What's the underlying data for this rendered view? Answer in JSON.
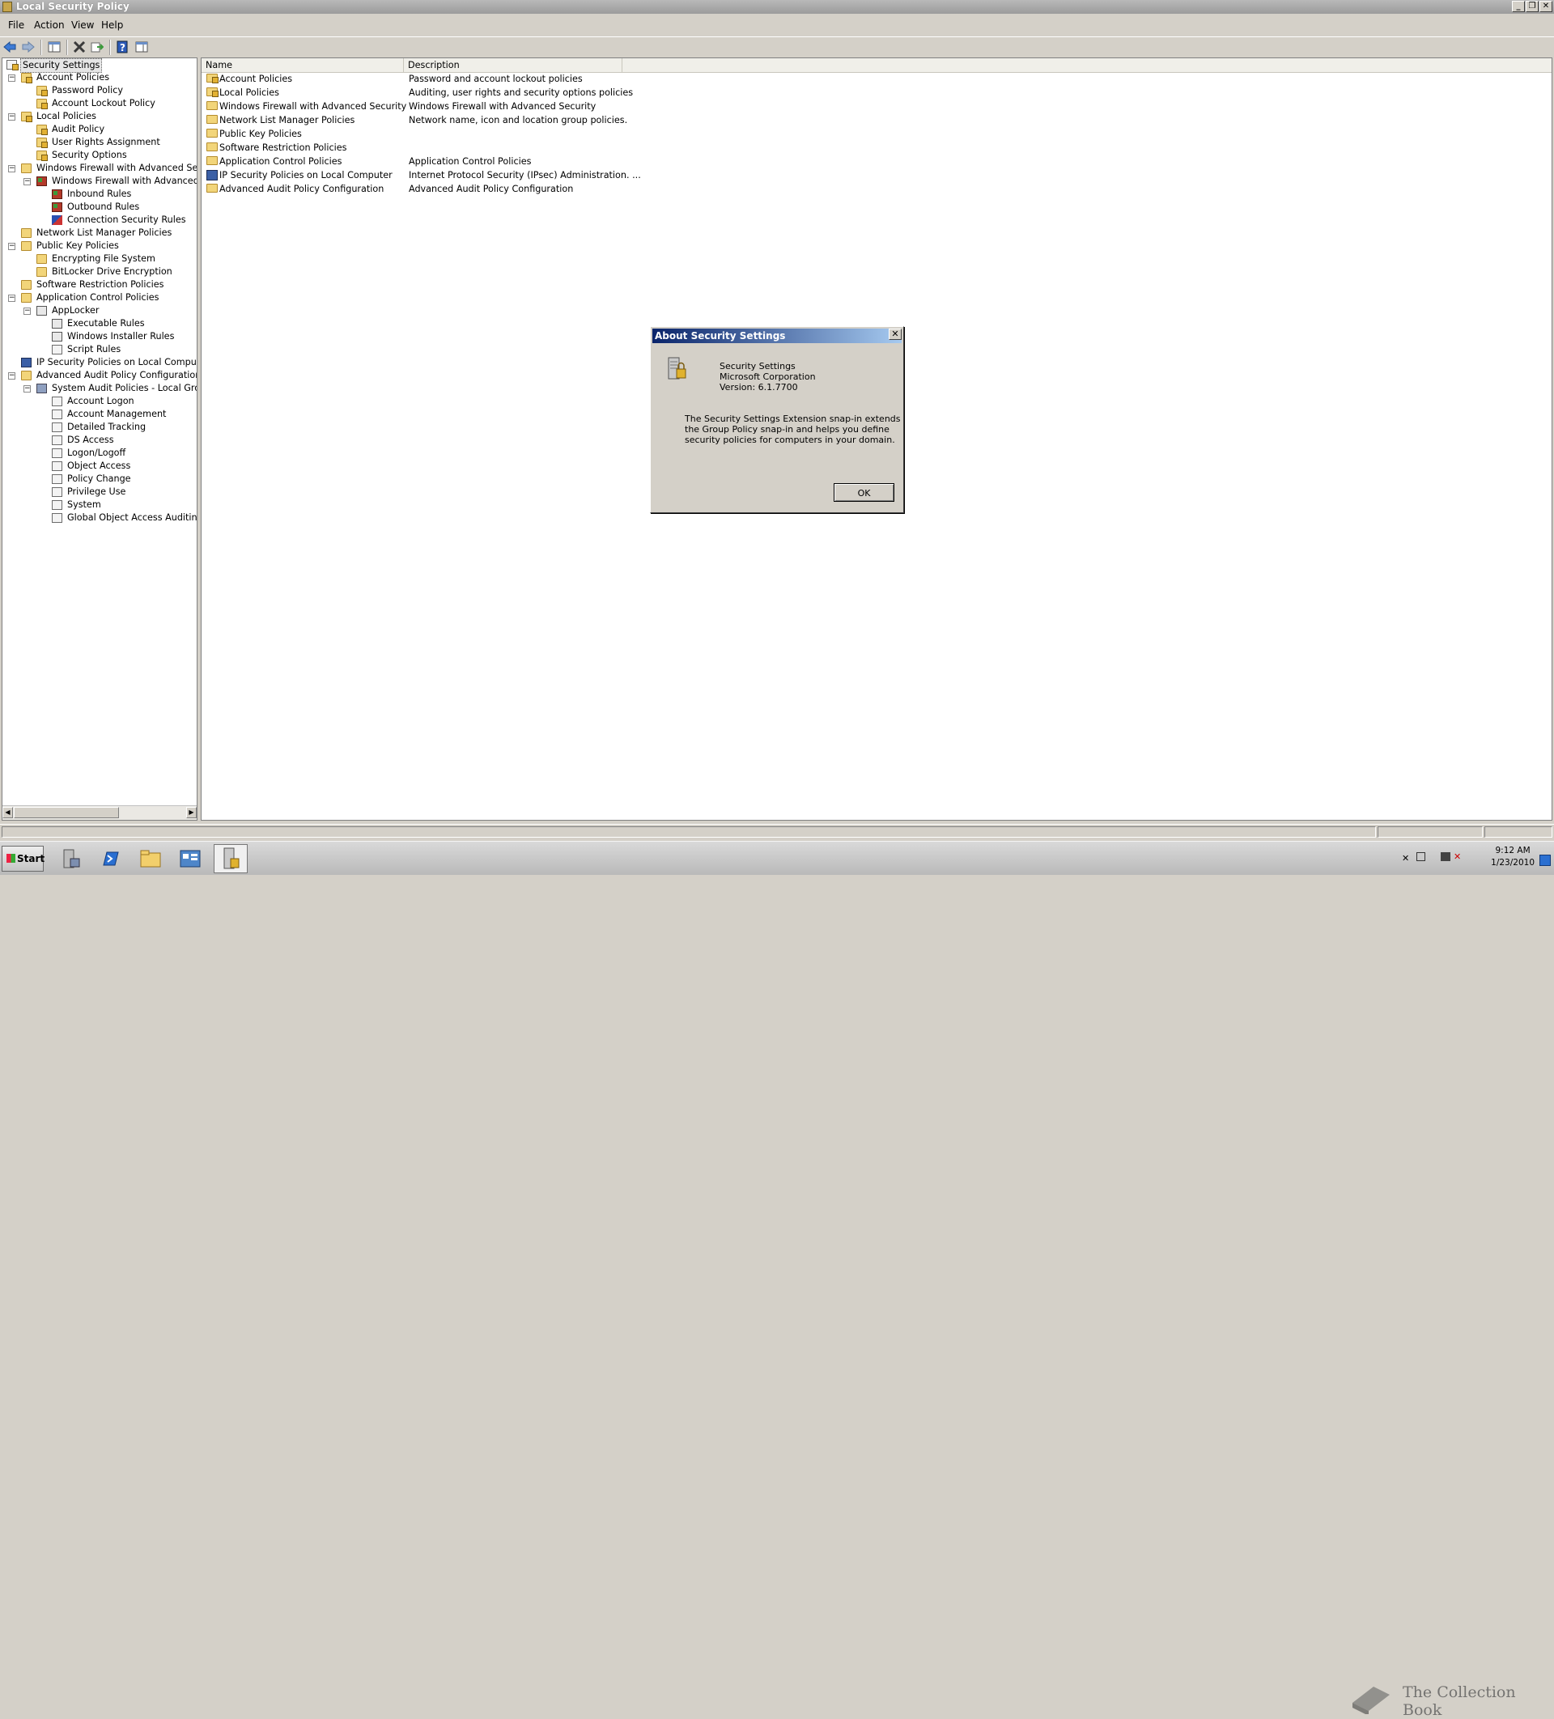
{
  "window": {
    "title": "Local Security Policy"
  },
  "menu": [
    "File",
    "Action",
    "View",
    "Help"
  ],
  "tree": [
    {
      "label": "Security Settings"
    },
    {
      "label": "Account Policies"
    },
    {
      "label": "Password Policy"
    },
    {
      "label": "Account Lockout Policy"
    },
    {
      "label": "Local Policies"
    },
    {
      "label": "Audit Policy"
    },
    {
      "label": "User Rights Assignment"
    },
    {
      "label": "Security Options"
    },
    {
      "label": "Windows Firewall with Advanced Security"
    },
    {
      "label": "Windows Firewall with Advanced Secu"
    },
    {
      "label": "Inbound Rules"
    },
    {
      "label": "Outbound Rules"
    },
    {
      "label": "Connection Security Rules"
    },
    {
      "label": "Network List Manager Policies"
    },
    {
      "label": "Public Key Policies"
    },
    {
      "label": "Encrypting File System"
    },
    {
      "label": "BitLocker Drive Encryption"
    },
    {
      "label": "Software Restriction Policies"
    },
    {
      "label": "Application Control Policies"
    },
    {
      "label": "AppLocker"
    },
    {
      "label": "Executable Rules"
    },
    {
      "label": "Windows Installer Rules"
    },
    {
      "label": "Script Rules"
    },
    {
      "label": "IP Security Policies on Local Computer"
    },
    {
      "label": "Advanced Audit Policy Configuration"
    },
    {
      "label": "System Audit Policies - Local Group Pc"
    },
    {
      "label": "Account Logon"
    },
    {
      "label": "Account Management"
    },
    {
      "label": "Detailed Tracking"
    },
    {
      "label": "DS Access"
    },
    {
      "label": "Logon/Logoff"
    },
    {
      "label": "Object Access"
    },
    {
      "label": "Policy Change"
    },
    {
      "label": "Privilege Use"
    },
    {
      "label": "System"
    },
    {
      "label": "Global Object Access Auditing"
    }
  ],
  "list": {
    "columns": [
      "Name",
      "Description"
    ],
    "rows": [
      {
        "name": "Account Policies",
        "description": "Password and account lockout policies"
      },
      {
        "name": "Local Policies",
        "description": "Auditing, user rights and security options policies"
      },
      {
        "name": "Windows Firewall with Advanced Security",
        "description": "Windows Firewall with Advanced Security"
      },
      {
        "name": "Network List Manager Policies",
        "description": "Network name, icon and location group policies."
      },
      {
        "name": "Public Key Policies",
        "description": ""
      },
      {
        "name": "Software Restriction Policies",
        "description": ""
      },
      {
        "name": "Application Control Policies",
        "description": "Application Control Policies"
      },
      {
        "name": "IP Security Policies on Local Computer",
        "description": "Internet Protocol Security (IPsec) Administration. ..."
      },
      {
        "name": "Advanced Audit Policy Configuration",
        "description": "Advanced Audit Policy Configuration"
      }
    ]
  },
  "dialog": {
    "title": "About Security Settings",
    "product": "Security Settings",
    "company": "Microsoft Corporation",
    "version": "Version: 6.1.7700",
    "description_lines": [
      "The Security Settings Extension snap-in extends",
      "the Group Policy snap-in and helps you define",
      "security policies for computers in your domain."
    ],
    "ok_label": "OK"
  },
  "taskbar": {
    "start_label": "Start",
    "watermark": "The Collection Book",
    "clock_time": "9:12 AM",
    "clock_date": "1/23/2010"
  },
  "colors": {
    "title_active": "#0a246a",
    "title_inactive": "#9b9b9b",
    "window_bg": "#d4d0c8"
  }
}
